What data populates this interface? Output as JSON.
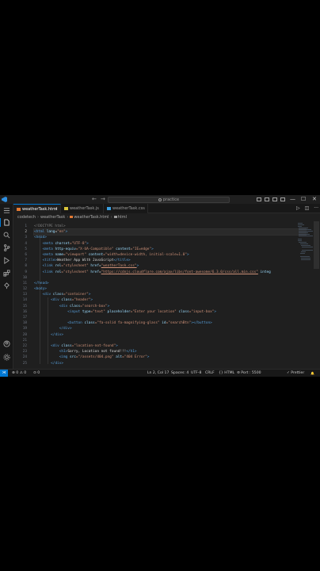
{
  "titlebar": {
    "back_arrow": "←",
    "forward_arrow": "→",
    "search_text": "practice",
    "controls": {
      "minimize": "—",
      "maximize": "☐",
      "close": "✕"
    }
  },
  "tabs": [
    {
      "label": "weatherTask.html",
      "active": true,
      "close": "✕",
      "icon_color": "#e37933"
    },
    {
      "label": "weatherTask.js",
      "active": false,
      "icon_color": "#d9c43a"
    },
    {
      "label": "weatherTask.css",
      "active": false,
      "icon_color": "#3b9fe0"
    }
  ],
  "tab_actions": {
    "run": "▷",
    "split": "◫",
    "more": "···"
  },
  "breadcrumb": [
    "codetech",
    "weatherTask",
    "weatherTask.html",
    "html"
  ],
  "gutter": [
    "1",
    "2",
    "3",
    "4",
    "5",
    "6",
    "7",
    "8",
    "9",
    "10",
    "11",
    "12",
    "13",
    "14",
    "15",
    "16",
    "17",
    "18",
    "19",
    "20",
    "21",
    "22",
    "23",
    "24",
    "25"
  ],
  "code": {
    "l1": "<!DOCTYPE html>",
    "l2_tag": "<html",
    "l2_attr": " lang",
    "l2_eq": "=",
    "l2_val": "\"en\"",
    "l2_close": ">",
    "l3": "<head>",
    "l4_tag": "<meta",
    "l4_attr": " charset",
    "l4_val": "=\"UTF-8\"",
    "l4_close": ">",
    "l5_tag": "<meta",
    "l5_attr1": " http-equiv",
    "l5_val1": "=\"X-UA-Compatible\"",
    "l5_attr2": " content",
    "l5_val2": "=\"IE=edge\"",
    "l5_close": ">",
    "l6_tag": "<meta",
    "l6_attr1": " name",
    "l6_val1": "=\"viewport\"",
    "l6_attr2": " content",
    "l6_val2": "=\"width=device-width, initial-scale=1.0\"",
    "l6_close": ">",
    "l7_tag1": "<title>",
    "l7_text": "Weather App With JavaScript",
    "l7_tag2": "</title>",
    "l8_tag": "<link",
    "l8_attr1": " rel",
    "l8_val1": "=\"stylesheet\"",
    "l8_attr2": " href",
    "l8_eq": "=",
    "l8_link": "\"weatherTask.css\"",
    "l8_close": ">",
    "l9_tag": "<link",
    "l9_attr1": " rel",
    "l9_val1": "=\"stylesheet\"",
    "l9_attr2": " href",
    "l9_eq": "=",
    "l9_link": "\"https://cdnjs.cloudflare.com/ajax/libs/font-awesome/6.3.0/css/all.min.css\"",
    "l9_attr3": " integ",
    "l10": "",
    "l11": "</head>",
    "l12": "<body>",
    "l13_tag": "<div",
    "l13_attr": " class",
    "l13_val": "=\"container\"",
    "l13_close": ">",
    "l14_tag": "<div",
    "l14_attr": " class",
    "l14_val": "=\"header\"",
    "l14_close": ">",
    "l15_tag": "<div",
    "l15_attr": " class",
    "l15_val": "=\"search-box\"",
    "l15_close": ">",
    "l16_tag": "<input",
    "l16_attr1": " type",
    "l16_val1": "=\"text\"",
    "l16_attr2": " placeholder",
    "l16_val2": "=\"Enter your location\"",
    "l16_attr3": " class",
    "l16_val3": "=\"input-box\"",
    "l16_close": ">",
    "l17": "",
    "l18_tag": "<button",
    "l18_attr1": " class",
    "l18_val1": "=\"fa-solid fa-magnifying-glass\"",
    "l18_attr2": " id",
    "l18_val2": "=\"searchBtn\"",
    "l18_close": "></button>",
    "l19": "</div>",
    "l20": "</div>",
    "l21": "",
    "l22_tag": "<div",
    "l22_attr": " class",
    "l22_val": "=\"location-not-found\"",
    "l22_close": ">",
    "l23_tag1": "<h1>",
    "l23_text": "Sorry, Location not found!!!",
    "l23_tag2": "</h1>",
    "l24_tag": "<img",
    "l24_attr1": " src",
    "l24_val1": "=\"/assets/404.png\"",
    "l24_attr2": " alt",
    "l24_val2": "=\"404 Error\"",
    "l24_close": ">",
    "l25": "</div>"
  },
  "status": {
    "remote": "⋊",
    "errors": "⊗ 0 ⚠ 0",
    "ports": "⊙ 0",
    "position": "Ln 2, Col 17",
    "spaces": "Spaces: 4",
    "encoding": "UTF-8",
    "eol": "CRLF",
    "language": "{} HTML",
    "port": "⊚ Port : 5500",
    "prettier": "✓ Prettier",
    "bell": "🔔"
  },
  "colors": {
    "accent": "#0078d4",
    "background": "#1f1f1f",
    "tag": "#569cd6",
    "attr": "#9cdcfe",
    "string": "#ce9178"
  }
}
